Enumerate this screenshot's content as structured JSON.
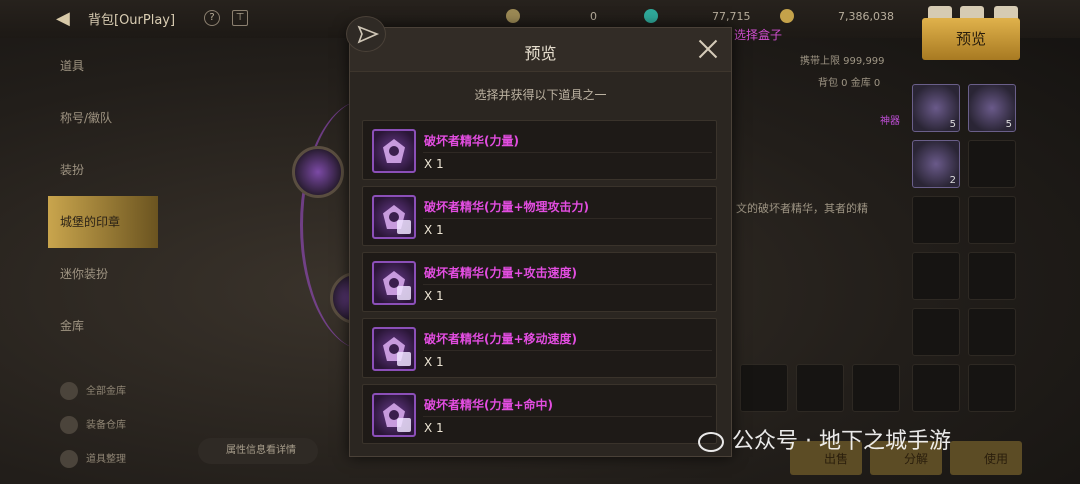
{
  "header": {
    "title": "背包[OurPlay]",
    "currency_values": [
      "0",
      "77,715",
      "7,386,038"
    ]
  },
  "sidebar": {
    "items": [
      "道具",
      "称号/徽队",
      "装扮",
      "城堡的印章",
      "迷你装扮",
      "金库"
    ],
    "active_index": 3,
    "lower_items": [
      "全部金库",
      "装备仓库",
      "道具整理"
    ]
  },
  "right_panel": {
    "preview_button": "预览",
    "select_box": "选择盒子",
    "limit_text": "携带上限 999,999",
    "counts": "背包 0  金库 0",
    "tag": "神器",
    "desc": "文的破坏者精华，其者的精",
    "slot_counts": [
      "5",
      "5",
      "2"
    ]
  },
  "hint_pill": "属性信息看详情",
  "modal": {
    "title": "预览",
    "subtitle": "选择并获得以下道具之一",
    "rewards": [
      {
        "name": "破坏者精华(力量)",
        "qty": "X 1",
        "icon": "essence-icon"
      },
      {
        "name": "破坏者精华(力量+物理攻击力)",
        "qty": "X 1",
        "icon": "essence-sword-icon"
      },
      {
        "name": "破坏者精华(力量+攻击速度)",
        "qty": "X 1",
        "icon": "essence-speed-icon"
      },
      {
        "name": "破坏者精华(力量+移动速度)",
        "qty": "X 1",
        "icon": "essence-boot-icon"
      },
      {
        "name": "破坏者精华(力量+命中)",
        "qty": "X 1",
        "icon": "essence-target-icon"
      }
    ]
  },
  "bottom_buttons": [
    "出售",
    "分解",
    "使用"
  ],
  "watermark": "公众号 · 地下之城手游",
  "colors": {
    "reward_name": "#e24de0",
    "gold_button": "#d6a63f",
    "panel": "#2b2621"
  }
}
